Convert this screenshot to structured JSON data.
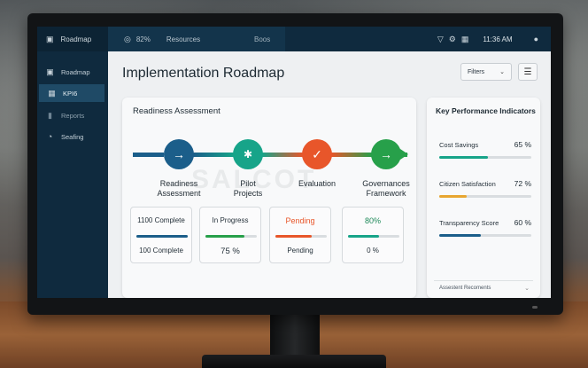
{
  "colors": {
    "navy": "#0f2a3e",
    "blue": "#1b5e8a",
    "teal": "#17a489",
    "orange": "#e8562a",
    "green": "#27a04a",
    "amber": "#e8a630"
  },
  "topbar": {
    "brand_label": "Roadmap",
    "brand_icon": "panel-icon",
    "zoom_label": "82%",
    "resources_label": "Resources",
    "extra_label": "Boos",
    "time": "11:36 AM",
    "icons": [
      "filter-icon",
      "wrench-icon",
      "dashboard-icon",
      "mic-icon"
    ]
  },
  "sidebar": {
    "items": [
      {
        "label": "Roadmap",
        "icon": "calendar-icon",
        "active": false
      },
      {
        "label": "KPI6",
        "icon": "grid-icon",
        "active": true
      },
      {
        "label": "Reports",
        "icon": "bar-chart-icon",
        "active": false
      },
      {
        "label": "Seafing",
        "icon": "pie-icon",
        "active": false
      }
    ]
  },
  "main": {
    "title": "Implementation Roadmap",
    "filters_label": "Filters",
    "menu_icon": "hamburger-icon"
  },
  "readiness": {
    "title": "Readiness Assessment",
    "watermark": "SALCOT",
    "steps": [
      {
        "label_line1": "Readiness",
        "label_line2": "Assessment",
        "icon": "arrow-right-icon"
      },
      {
        "label_line1": "Pilot",
        "label_line2": "Projects",
        "icon": "bluetooth-icon"
      },
      {
        "label_line1": "Evaluation",
        "label_line2": "",
        "icon": "check-icon"
      },
      {
        "label_line1": "Governances",
        "label_line2": "Framework",
        "icon": "arrow-right-icon"
      }
    ],
    "stats": [
      {
        "top": "1100 Complete",
        "bottom": "100 Complete",
        "progress": 1.0
      },
      {
        "top": "In Progress",
        "bottom": "75 %",
        "progress": 0.75
      },
      {
        "top": "Pending",
        "bottom": "Pending",
        "progress": 0.7
      },
      {
        "top": "80%",
        "bottom": "0 %",
        "progress": 0.6
      }
    ]
  },
  "kpi": {
    "title": "Key Performance Indicators",
    "items": [
      {
        "name": "Cost Savings",
        "value": "65 %",
        "progress": 0.53
      },
      {
        "name": "Citizen Satisfaction",
        "value": "72 %",
        "progress": 0.3
      },
      {
        "name": "Transparency Score",
        "value": "60 %",
        "progress": 0.45
      }
    ],
    "footer_label": "Assestent Recoments"
  }
}
